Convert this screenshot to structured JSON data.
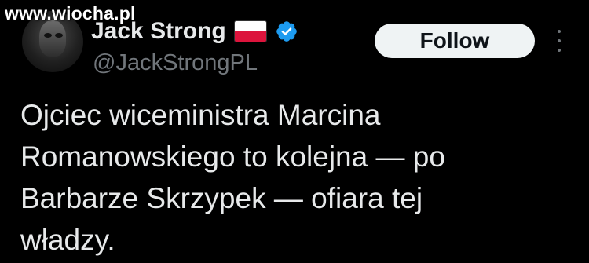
{
  "watermark": "www.wiocha.pl",
  "author": {
    "display_name": "Jack Strong",
    "handle": "@JackStrongPL",
    "flag_icon": "poland-flag-icon",
    "verified_icon": "verified-badge-icon",
    "verified_color": "#1d9bf0"
  },
  "actions": {
    "follow_label": "Follow",
    "more_icon": "more-options-icon"
  },
  "tweet": {
    "lines": [
      "Ojciec wiceministra Marcina",
      "Romanowskiego to kolejna — po",
      "Barbarze Skrzypek — ofiara tej",
      "władzy."
    ]
  },
  "colors": {
    "background": "#000000",
    "text_primary": "#e7e9ea",
    "text_secondary": "#71767b",
    "button_bg": "#eff3f4",
    "button_text": "#0f1419",
    "flag_white": "#ffffff",
    "flag_red": "#dc143c"
  }
}
